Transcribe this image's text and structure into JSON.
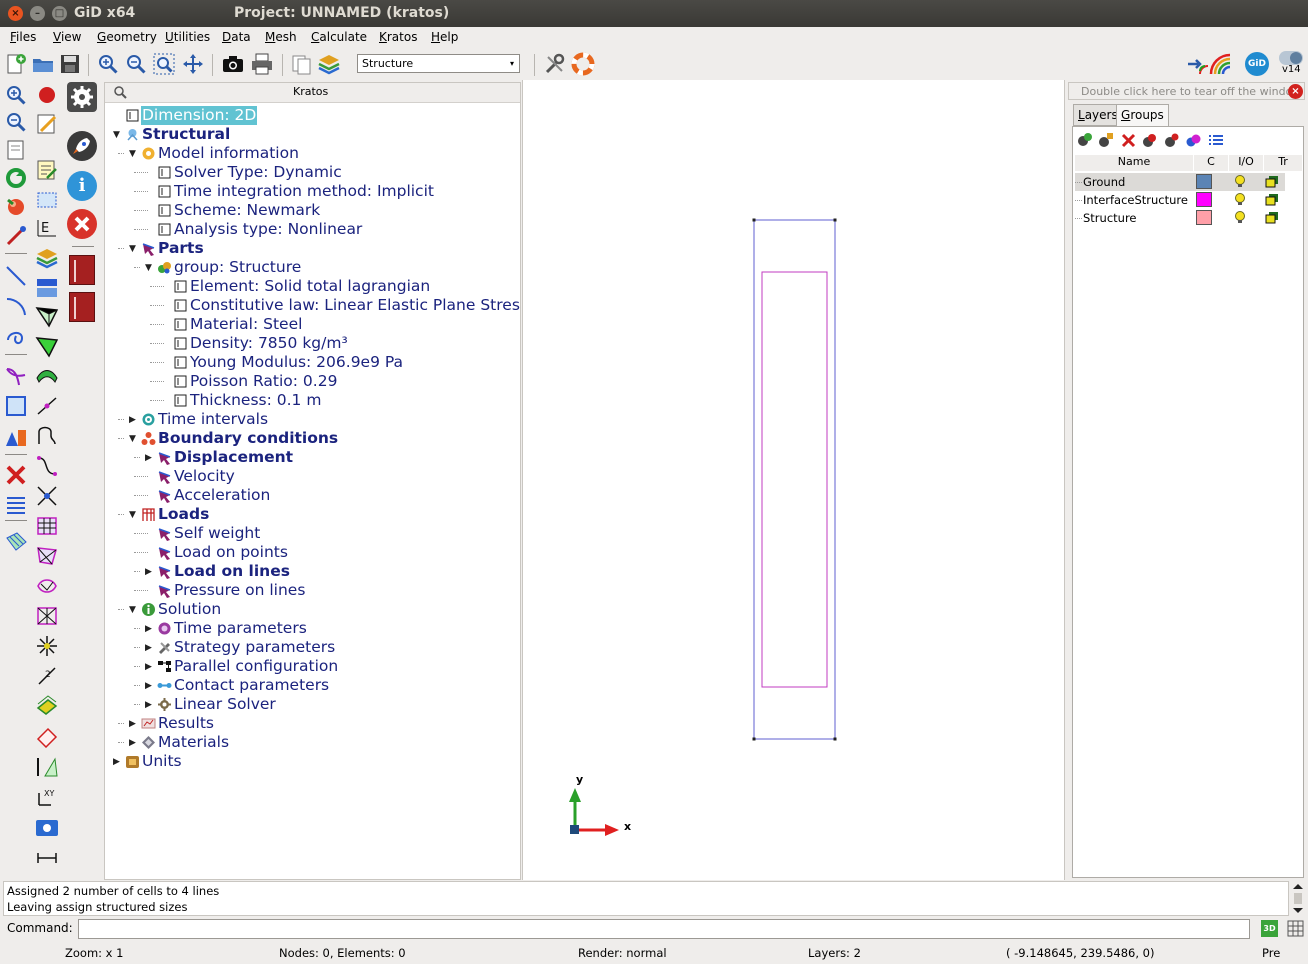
{
  "window": {
    "app_name": "GiD x64",
    "project_title": "Project: UNNAMED (kratos)",
    "close_glyph": "×",
    "min_glyph": "–",
    "max_glyph": "□"
  },
  "menu": [
    "Files",
    "View",
    "Geometry",
    "Utilities",
    "Data",
    "Mesh",
    "Calculate",
    "Kratos",
    "Help"
  ],
  "toolbar": {
    "layer_combo_value": "Structure",
    "combo_arrow_glyph": "▾",
    "version_label": "v14",
    "gid_logo_text": "GiD"
  },
  "tree_panel": {
    "title": "Kratos",
    "rows": [
      {
        "label": "Dimension: 2D",
        "level": 0,
        "expander": "",
        "icon": "leaf",
        "bold": false,
        "selected": true
      },
      {
        "label": "Structural",
        "level": 0,
        "expander": "open",
        "icon": "structural",
        "bold": true
      },
      {
        "label": "Model information",
        "level": 1,
        "expander": "open",
        "icon": "info-orange",
        "bold": false
      },
      {
        "label": "Solver Type: Dynamic",
        "level": 2,
        "expander": "",
        "icon": "leaf",
        "bold": false
      },
      {
        "label": "Time integration method: Implicit",
        "level": 2,
        "expander": "",
        "icon": "leaf",
        "bold": false
      },
      {
        "label": "Scheme: Newmark",
        "level": 2,
        "expander": "",
        "icon": "leaf",
        "bold": false
      },
      {
        "label": "Analysis type: Nonlinear",
        "level": 2,
        "expander": "",
        "icon": "leaf",
        "bold": false
      },
      {
        "label": "Parts",
        "level": 1,
        "expander": "open",
        "icon": "parts",
        "bold": true
      },
      {
        "label": "group: Structure",
        "level": 2,
        "expander": "open",
        "icon": "group",
        "bold": false
      },
      {
        "label": "Element: Solid total lagrangian",
        "level": 3,
        "expander": "",
        "icon": "leaf",
        "bold": false
      },
      {
        "label": "Constitutive law: Linear Elastic Plane Stress",
        "level": 3,
        "expander": "",
        "icon": "leaf",
        "bold": false
      },
      {
        "label": "Material: Steel",
        "level": 3,
        "expander": "",
        "icon": "leaf",
        "bold": false
      },
      {
        "label": "Density: 7850 kg/m³",
        "level": 3,
        "expander": "",
        "icon": "leaf",
        "bold": false
      },
      {
        "label": "Young Modulus: 206.9e9 Pa",
        "level": 3,
        "expander": "",
        "icon": "leaf",
        "bold": false
      },
      {
        "label": "Poisson Ratio: 0.29",
        "level": 3,
        "expander": "",
        "icon": "leaf",
        "bold": false
      },
      {
        "label": "Thickness: 0.1 m",
        "level": 3,
        "expander": "",
        "icon": "leaf",
        "bold": false
      },
      {
        "label": "Time intervals",
        "level": 1,
        "expander": "closed",
        "icon": "time",
        "bold": false
      },
      {
        "label": "Boundary conditions",
        "level": 1,
        "expander": "open",
        "icon": "bc",
        "bold": true
      },
      {
        "label": "Displacement",
        "level": 2,
        "expander": "closed",
        "icon": "parts",
        "bold": true
      },
      {
        "label": "Velocity",
        "level": 2,
        "expander": "",
        "icon": "parts",
        "bold": false
      },
      {
        "label": "Acceleration",
        "level": 2,
        "expander": "",
        "icon": "parts",
        "bold": false
      },
      {
        "label": "Loads",
        "level": 1,
        "expander": "open",
        "icon": "loads",
        "bold": true
      },
      {
        "label": "Self weight",
        "level": 2,
        "expander": "",
        "icon": "parts",
        "bold": false
      },
      {
        "label": "Load on points",
        "level": 2,
        "expander": "",
        "icon": "parts",
        "bold": false
      },
      {
        "label": "Load on lines",
        "level": 2,
        "expander": "closed",
        "icon": "parts",
        "bold": true
      },
      {
        "label": "Pressure on lines",
        "level": 2,
        "expander": "",
        "icon": "parts",
        "bold": false
      },
      {
        "label": "Solution",
        "level": 1,
        "expander": "open",
        "icon": "solution",
        "bold": false
      },
      {
        "label": "Time parameters",
        "level": 2,
        "expander": "closed",
        "icon": "time-params",
        "bold": false
      },
      {
        "label": "Strategy parameters",
        "level": 2,
        "expander": "closed",
        "icon": "strategy",
        "bold": false
      },
      {
        "label": "Parallel configuration",
        "level": 2,
        "expander": "closed",
        "icon": "parallel",
        "bold": false
      },
      {
        "label": "Contact parameters",
        "level": 2,
        "expander": "closed",
        "icon": "contact",
        "bold": false
      },
      {
        "label": "Linear Solver",
        "level": 2,
        "expander": "closed",
        "icon": "gear",
        "bold": false
      },
      {
        "label": "Results",
        "level": 1,
        "expander": "closed",
        "icon": "results",
        "bold": false
      },
      {
        "label": "Materials",
        "level": 1,
        "expander": "closed",
        "icon": "materials",
        "bold": false
      },
      {
        "label": "Units",
        "level": 0,
        "expander": "closed",
        "icon": "units",
        "bold": false
      }
    ]
  },
  "graphics": {
    "axis_x_label": "x",
    "axis_y_label": "y",
    "outer_rect_color": "#5f5fd0",
    "inner_rect_color": "#c23bc2"
  },
  "right_panel": {
    "tearoff_text": "Double click here to tear off the window",
    "tearoff_close_glyph": "×",
    "tabs": [
      {
        "label": "Layers",
        "active": false
      },
      {
        "label": "Groups",
        "active": true
      }
    ],
    "columns": {
      "name": "Name",
      "color": "C",
      "io": "I/O",
      "tr": "Tr"
    },
    "groups": [
      {
        "name": "Ground",
        "color": "#5b84b5",
        "selected": true
      },
      {
        "name": "InterfaceStructure",
        "color": "#ff00ff",
        "selected": false
      },
      {
        "name": "Structure",
        "color": "#ff9fa8",
        "selected": false
      }
    ]
  },
  "messages": {
    "lines": [
      "Assigned 2 number of cells to 4 lines",
      "Leaving assign structured sizes"
    ],
    "command_label": "Command:",
    "command_value": ""
  },
  "status": {
    "zoom": "Zoom: x 1",
    "nodes": "Nodes: 0, Elements: 0",
    "render": "Render: normal",
    "layers": "Layers: 2",
    "coords": "( -9.148645, 239.5486, 0)",
    "mode": "Pre"
  }
}
